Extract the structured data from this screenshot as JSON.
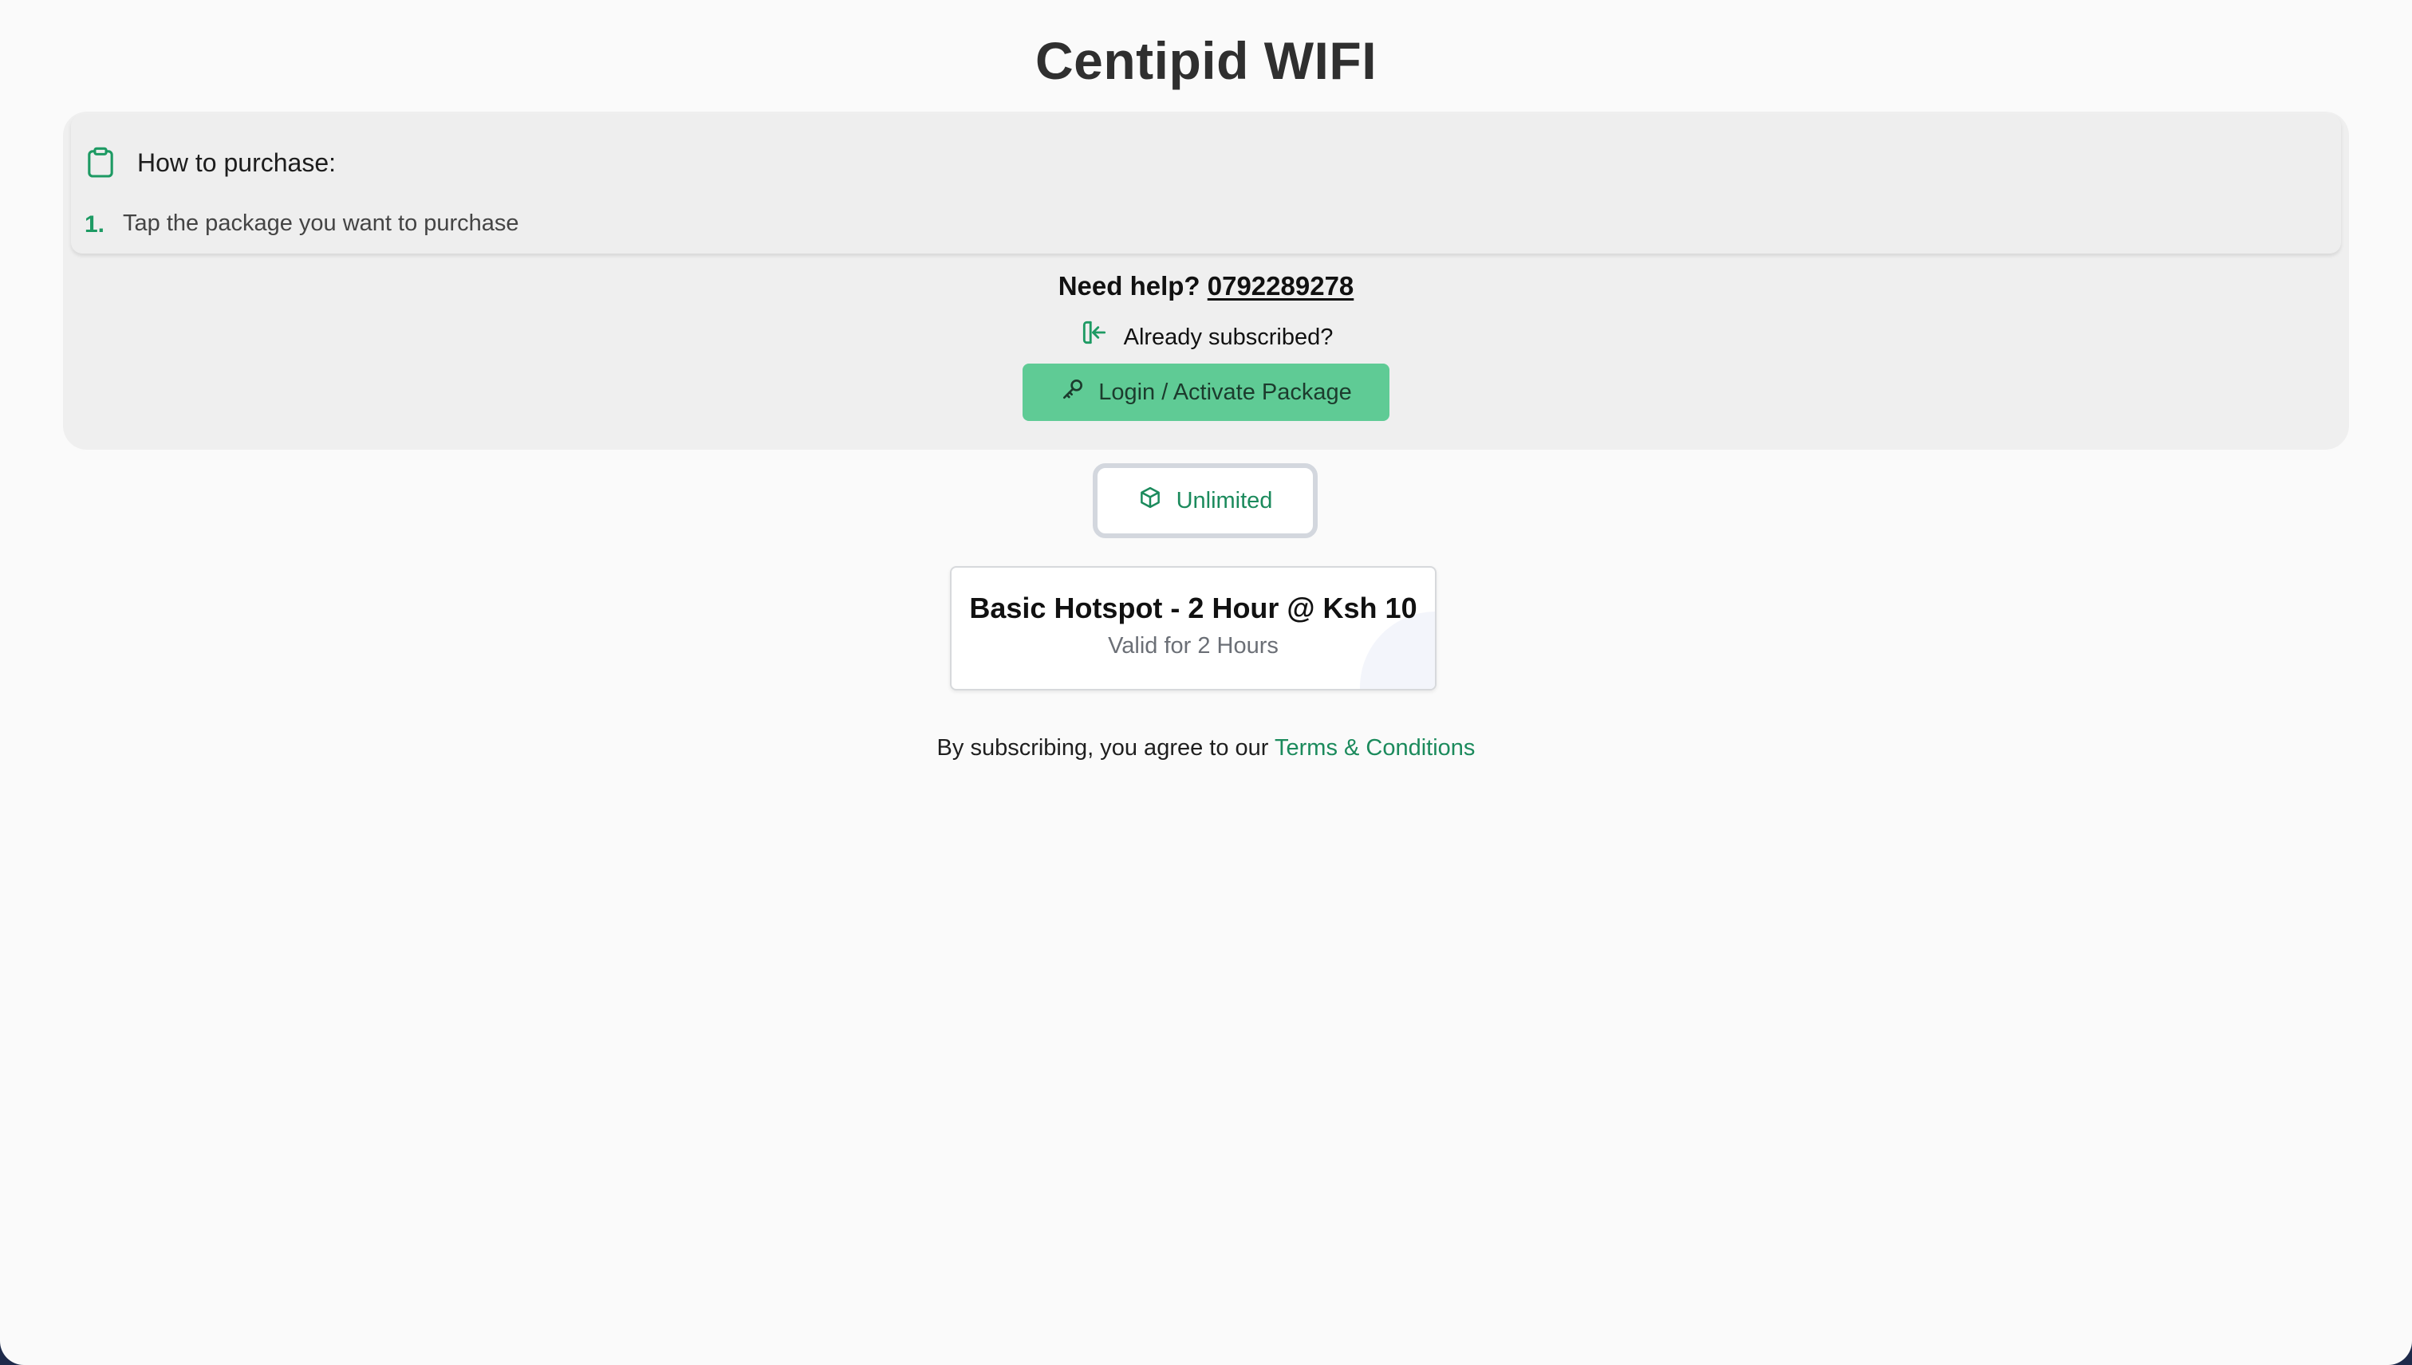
{
  "header": {
    "title": "Centipid WIFI"
  },
  "instructions": {
    "heading": "How to purchase:",
    "steps": [
      {
        "number": "1.",
        "text": "Tap the package you want to purchase"
      }
    ]
  },
  "help": {
    "prefix": "Need help?",
    "phone": "0792289278"
  },
  "subscribed": {
    "text": "Already subscribed?"
  },
  "login_button": {
    "label": "Login / Activate Package"
  },
  "tabs": [
    {
      "label": "Unlimited",
      "icon": "package-box-icon",
      "selected": true
    }
  ],
  "packages": [
    {
      "title": "Basic Hotspot - 2 Hour @ Ksh 10",
      "validity": "Valid for 2 Hours"
    }
  ],
  "terms": {
    "prefix": "By subscribing, you agree to our",
    "link_label": "Terms & Conditions"
  },
  "colors": {
    "accent": "#1b8a5c",
    "button_bg": "#5fcb95",
    "page_bg": "#fafafa",
    "panel_bg": "#efefef"
  }
}
